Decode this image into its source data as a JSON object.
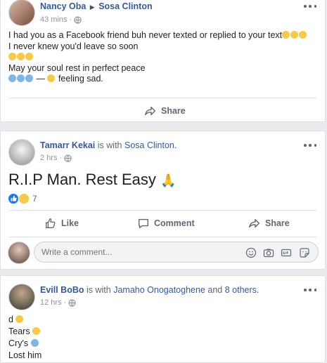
{
  "posts": [
    {
      "author": "Nancy Oba",
      "target": "Sosa Clinton",
      "time": "43 mins",
      "lines": [
        "I had you as a Facebook friend buh never texted or replied to your text",
        "I never knew you'd leave so soon",
        "May your soul rest in perfect peace",
        "— ",
        "feeling sad."
      ],
      "share_label": "Share"
    },
    {
      "author": "Tamarr Kekai",
      "with_text": "is with",
      "tagged": "Sosa Clinton.",
      "time": "2 hrs",
      "headline": "R.I.P Man. Rest Easy",
      "reaction_count": "7",
      "like_label": "Like",
      "comment_label": "Comment",
      "share_label": "Share",
      "comment_placeholder": "Write a comment..."
    },
    {
      "author": "Evill BoBo",
      "with_text": "is with",
      "tagged": "Jamaho Onogatoghene",
      "and_text": "and",
      "others": "8 others.",
      "time": "12 hrs",
      "lines": [
        "d",
        "Tears",
        "Cry's",
        "Lost him"
      ]
    }
  ],
  "icons": [
    "globe-icon",
    "more-icon",
    "share-icon",
    "like-icon",
    "comment-icon",
    "emoji-icon",
    "camera-icon",
    "gif-icon",
    "sticker-icon"
  ],
  "colors": {
    "link": "#365899",
    "meta": "#90949c",
    "action": "#606770",
    "bg": "#e9ebee",
    "like_blue": "#1877f2"
  }
}
